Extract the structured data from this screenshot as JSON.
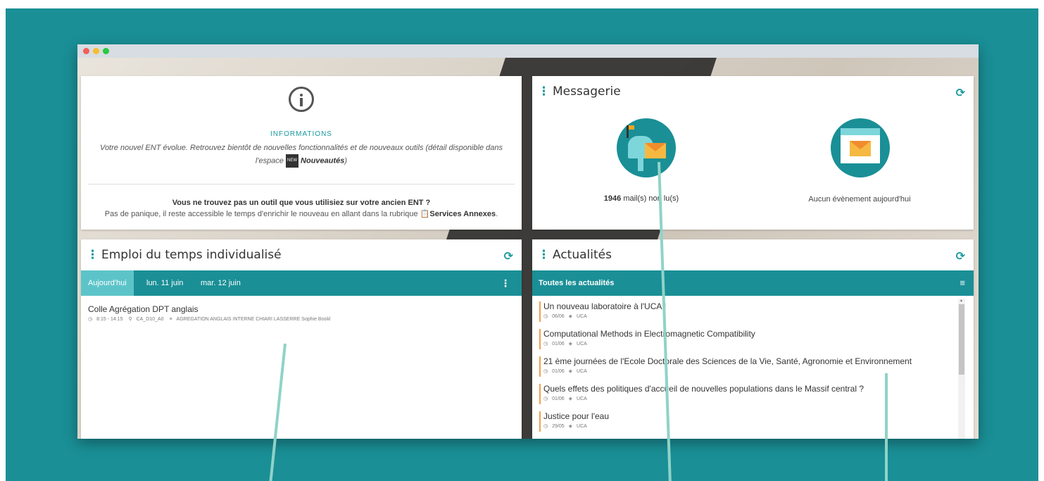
{
  "info": {
    "heading": "INFORMATIONS",
    "text_before": "Votre nouvel ENT évolue. Retrouvez bientôt de nouvelles fonctionnalités et de nouveaux outils (détail disponible dans l'espace ",
    "badge": "NEW",
    "link": "Nouveautés",
    "text_after": ")",
    "question": "Vous ne trouvez pas un outil que vous utilisiez sur votre ancien ENT ?",
    "sub_before": "Pas de panique, il reste accessible le temps d'enrichir le nouveau en allant dans la rubrique ",
    "sub_link": "Services Annexes",
    "sub_after": "."
  },
  "messagerie": {
    "title": "Messagerie",
    "count": "1946",
    "count_label": " mail(s) non lu(s)",
    "no_event": "Aucun évènement aujourd'hui"
  },
  "edt": {
    "title": "Emploi du temps individualisé",
    "tabs": [
      "Aujourd'hui",
      "lun. 11 juin",
      "mar. 12 juin"
    ],
    "course": {
      "title": "Colle Agrégation DPT anglais",
      "time": "8:15 - 14:15",
      "room": "CA_D10_A0",
      "group": "AGREGATION ANGLAIS INTERNE CHIARI LASSERRE Sophie Bookl"
    }
  },
  "actualites": {
    "title": "Actualités",
    "bar_label": "Toutes les actualités",
    "items": [
      {
        "title": "Un nouveau laboratoire à l'UCA !",
        "date": "06/06",
        "source": "UCA"
      },
      {
        "title": "Computational Methods in Electromagnetic Compatibility",
        "date": "01/06",
        "source": "UCA"
      },
      {
        "title": "21 ème journées de l'Ecole Doctorale des Sciences de la Vie, Santé, Agronomie et Environnement",
        "date": "01/06",
        "source": "UCA"
      },
      {
        "title": "Quels effets des politiques d'accueil de nouvelles populations dans le Massif central ?",
        "date": "01/06",
        "source": "UCA"
      },
      {
        "title": "Justice pour l'eau",
        "date": "29/05",
        "source": "UCA"
      }
    ]
  },
  "colors": {
    "teal": "#1a8f96",
    "teal_light": "#5cc4c9",
    "accent_orange": "#f0a050"
  }
}
